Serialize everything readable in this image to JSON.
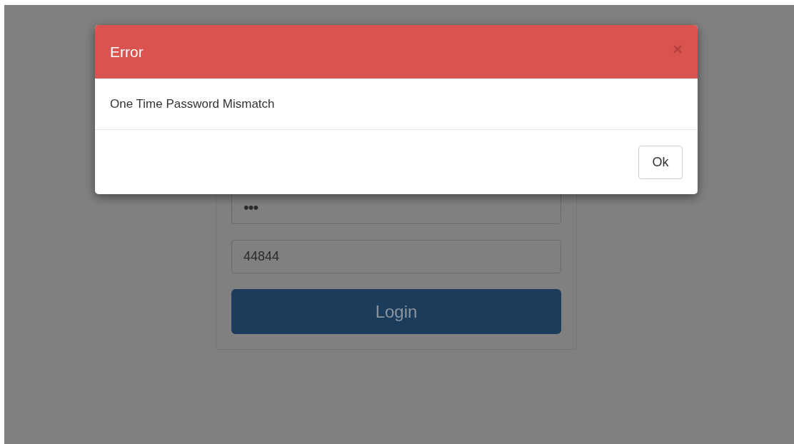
{
  "login_form": {
    "fields": [
      {
        "kind": "password",
        "value": "•••"
      },
      {
        "kind": "text",
        "value": "44844"
      }
    ],
    "submit_button": "Login"
  },
  "modal": {
    "title": "Error",
    "close": "×",
    "message": "One Time Password Mismatch",
    "button": "Ok"
  }
}
